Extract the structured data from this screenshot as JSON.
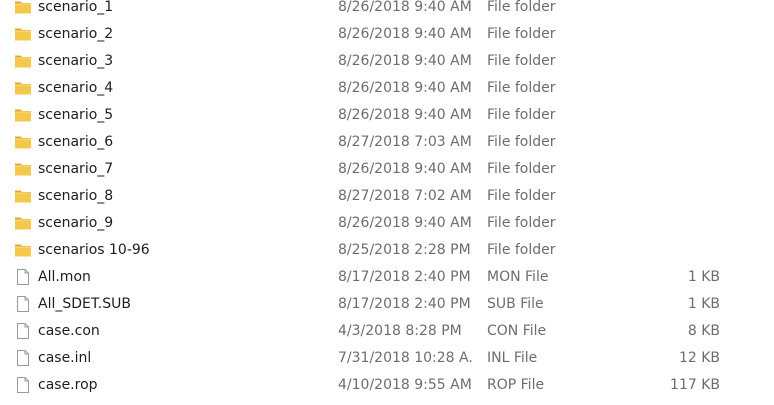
{
  "colors": {
    "folder_body": "#f4c84a",
    "folder_tab": "#e0a92c",
    "file_icon_border": "#9a9a9a",
    "secondary_text": "#6d6d6d"
  },
  "files": [
    {
      "name": "scenario_1",
      "date": "8/26/2018 9:40 AM",
      "type": "File folder",
      "size": "",
      "icon": "folder-icon"
    },
    {
      "name": "scenario_2",
      "date": "8/26/2018 9:40 AM",
      "type": "File folder",
      "size": "",
      "icon": "folder-icon"
    },
    {
      "name": "scenario_3",
      "date": "8/26/2018 9:40 AM",
      "type": "File folder",
      "size": "",
      "icon": "folder-icon"
    },
    {
      "name": "scenario_4",
      "date": "8/26/2018 9:40 AM",
      "type": "File folder",
      "size": "",
      "icon": "folder-icon"
    },
    {
      "name": "scenario_5",
      "date": "8/26/2018 9:40 AM",
      "type": "File folder",
      "size": "",
      "icon": "folder-icon"
    },
    {
      "name": "scenario_6",
      "date": "8/27/2018 7:03 AM",
      "type": "File folder",
      "size": "",
      "icon": "folder-icon"
    },
    {
      "name": "scenario_7",
      "date": "8/26/2018 9:40 AM",
      "type": "File folder",
      "size": "",
      "icon": "folder-icon"
    },
    {
      "name": "scenario_8",
      "date": "8/27/2018 7:02 AM",
      "type": "File folder",
      "size": "",
      "icon": "folder-icon"
    },
    {
      "name": "scenario_9",
      "date": "8/26/2018 9:40 AM",
      "type": "File folder",
      "size": "",
      "icon": "folder-icon"
    },
    {
      "name": "scenarios 10-96",
      "date": "8/25/2018 2:28 PM",
      "type": "File folder",
      "size": "",
      "icon": "folder-icon"
    },
    {
      "name": "All.mon",
      "date": "8/17/2018 2:40 PM",
      "type": "MON File",
      "size": "1 KB",
      "icon": "file-icon"
    },
    {
      "name": "All_SDET.SUB",
      "date": "8/17/2018 2:40 PM",
      "type": "SUB File",
      "size": "1 KB",
      "icon": "file-icon"
    },
    {
      "name": "case.con",
      "date": "4/3/2018 8:28 PM",
      "type": "CON File",
      "size": "8 KB",
      "icon": "file-icon"
    },
    {
      "name": "case.inl",
      "date": "7/31/2018 10:28 A...",
      "type": "INL File",
      "size": "12 KB",
      "icon": "file-icon"
    },
    {
      "name": "case.rop",
      "date": "4/10/2018 9:55 AM",
      "type": "ROP File",
      "size": "117 KB",
      "icon": "file-icon"
    }
  ]
}
